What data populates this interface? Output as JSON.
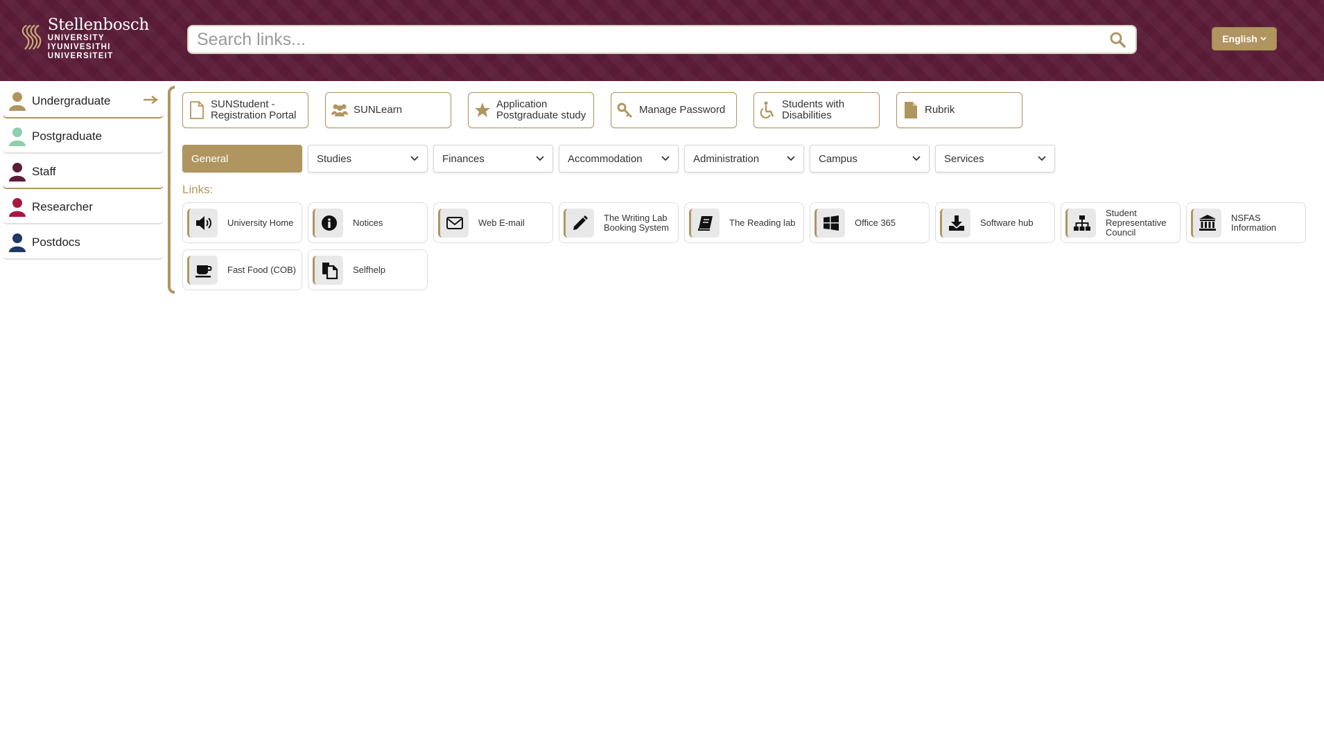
{
  "header": {
    "logo": {
      "name": "Stellenbosch",
      "line1": "UNIVERSITY",
      "line2": "IYUNIVESITHI",
      "line3": "UNIVERSITEIT"
    },
    "search": {
      "placeholder": "Search links..."
    },
    "language_label": "English"
  },
  "sidebar": {
    "items": [
      {
        "label": "Undergraduate",
        "color": "#b09560"
      },
      {
        "label": "Postgraduate",
        "color": "#8fcfb0"
      },
      {
        "label": "Staff",
        "color": "#5c1d39"
      },
      {
        "label": "Researcher",
        "color": "#a8193f"
      },
      {
        "label": "Postdocs",
        "color": "#1f3864"
      }
    ]
  },
  "quick_links": [
    {
      "label": "SUNStudent - Registration Portal",
      "icon": "document-icon"
    },
    {
      "label": "SUNLearn",
      "icon": "users-icon"
    },
    {
      "label": "Application Postgraduate study",
      "icon": "star-icon"
    },
    {
      "label": "Manage Password",
      "icon": "key-icon"
    },
    {
      "label": "Students with Disabilities",
      "icon": "wheelchair-icon"
    },
    {
      "label": "Rubrik",
      "icon": "file-icon"
    }
  ],
  "tabs": [
    {
      "label": "General"
    },
    {
      "label": "Studies"
    },
    {
      "label": "Finances"
    },
    {
      "label": "Accommodation"
    },
    {
      "label": "Administration"
    },
    {
      "label": "Campus"
    },
    {
      "label": "Services"
    }
  ],
  "links_label": "Links:",
  "links": [
    {
      "label": "University Home",
      "icon": "speaker-icon"
    },
    {
      "label": "Notices",
      "icon": "info-icon"
    },
    {
      "label": "Web E-mail",
      "icon": "envelope-icon"
    },
    {
      "label": "The Writing Lab Booking System",
      "icon": "pencil-icon"
    },
    {
      "label": "The Reading lab",
      "icon": "book-icon"
    },
    {
      "label": "Office 365",
      "icon": "windows-icon"
    },
    {
      "label": "Software hub",
      "icon": "download-icon"
    },
    {
      "label": "Student Representative Council",
      "icon": "sitemap-icon"
    },
    {
      "label": "NSFAS Information",
      "icon": "bank-icon"
    },
    {
      "label": "Fast Food (COB)",
      "icon": "coffee-icon"
    },
    {
      "label": "Selfhelp",
      "icon": "copy-icon"
    }
  ],
  "colors": {
    "brand": "#5c1d39",
    "accent": "#b09560"
  }
}
